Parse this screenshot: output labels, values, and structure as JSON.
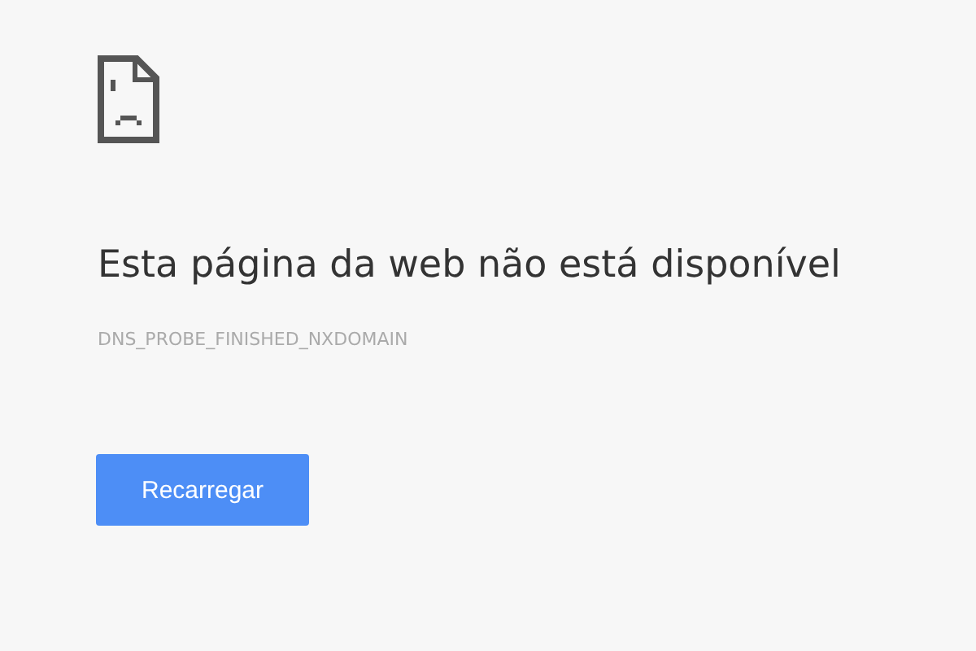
{
  "heading": "Esta página da web não está disponível",
  "error_code": "DNS_PROBE_FINISHED_NXDOMAIN",
  "buttons": [
    {
      "label": "Recarregar"
    }
  ]
}
